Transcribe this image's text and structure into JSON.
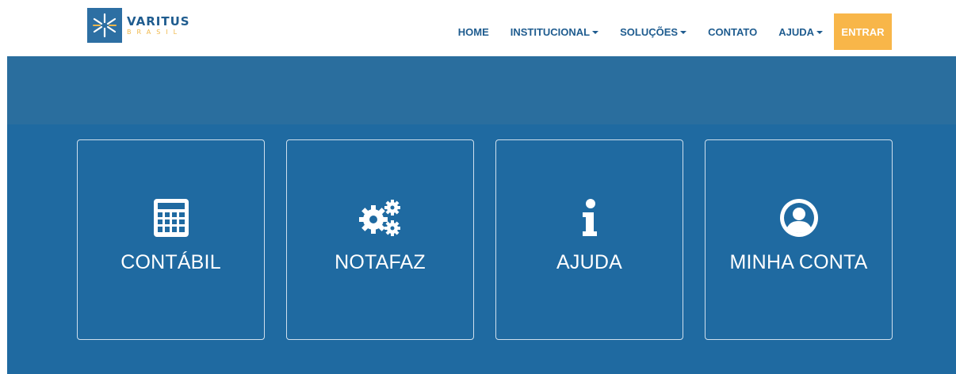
{
  "brand": {
    "name": "VARITUS",
    "subtitle": "BRASIL"
  },
  "nav": {
    "items": [
      {
        "label": "HOME",
        "dropdown": false
      },
      {
        "label": "INSTITUCIONAL",
        "dropdown": true
      },
      {
        "label": "SOLUÇÕES",
        "dropdown": true
      },
      {
        "label": "CONTATO",
        "dropdown": false
      },
      {
        "label": "AJUDA",
        "dropdown": true
      }
    ],
    "login_label": "ENTRAR"
  },
  "cards": [
    {
      "label": "CONTÁBIL",
      "icon": "calculator-icon"
    },
    {
      "label": "NOTAFAZ",
      "icon": "gears-icon"
    },
    {
      "label": "AJUDA",
      "icon": "info-icon"
    },
    {
      "label": "MINHA CONTA",
      "icon": "user-circle-icon"
    }
  ],
  "colors": {
    "brand_blue": "#1f5c8f",
    "accent_orange": "#f8b649",
    "hero_band": "#2a6e9e",
    "main_bg": "#1f6aa1"
  }
}
